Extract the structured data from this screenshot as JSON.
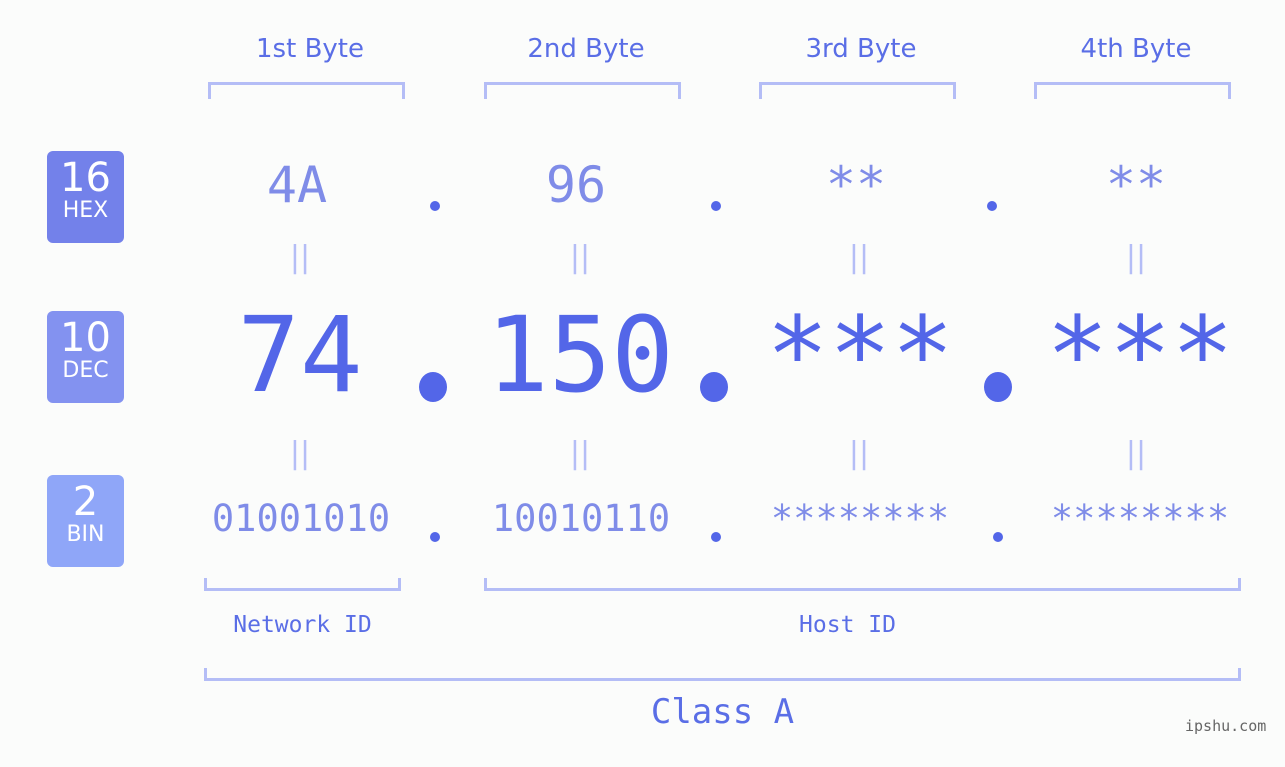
{
  "bytes": [
    {
      "label": "1st Byte",
      "hex": "4A",
      "dec": "74",
      "bin": "01001010"
    },
    {
      "label": "2nd Byte",
      "hex": "96",
      "dec": "150",
      "bin": "10010110"
    },
    {
      "label": "3rd Byte",
      "hex": "**",
      "dec": "***",
      "bin": "********"
    },
    {
      "label": "4th Byte",
      "hex": "**",
      "dec": "***",
      "bin": "********"
    }
  ],
  "bases": {
    "hex": {
      "num": "16",
      "label": "HEX",
      "color": "#7381ea"
    },
    "dec": {
      "num": "10",
      "label": "DEC",
      "color": "#8392f0"
    },
    "bin": {
      "num": "2",
      "label": "BIN",
      "color": "#8fa6f8"
    }
  },
  "equals_symbol": "||",
  "network_id_label": "Network ID",
  "host_id_label": "Host ID",
  "class_label": "Class A",
  "watermark": "ipshu.com",
  "colors": {
    "accent": "#5366e8",
    "light": "#7f8ce8",
    "bracket": "#b4bdf6"
  }
}
